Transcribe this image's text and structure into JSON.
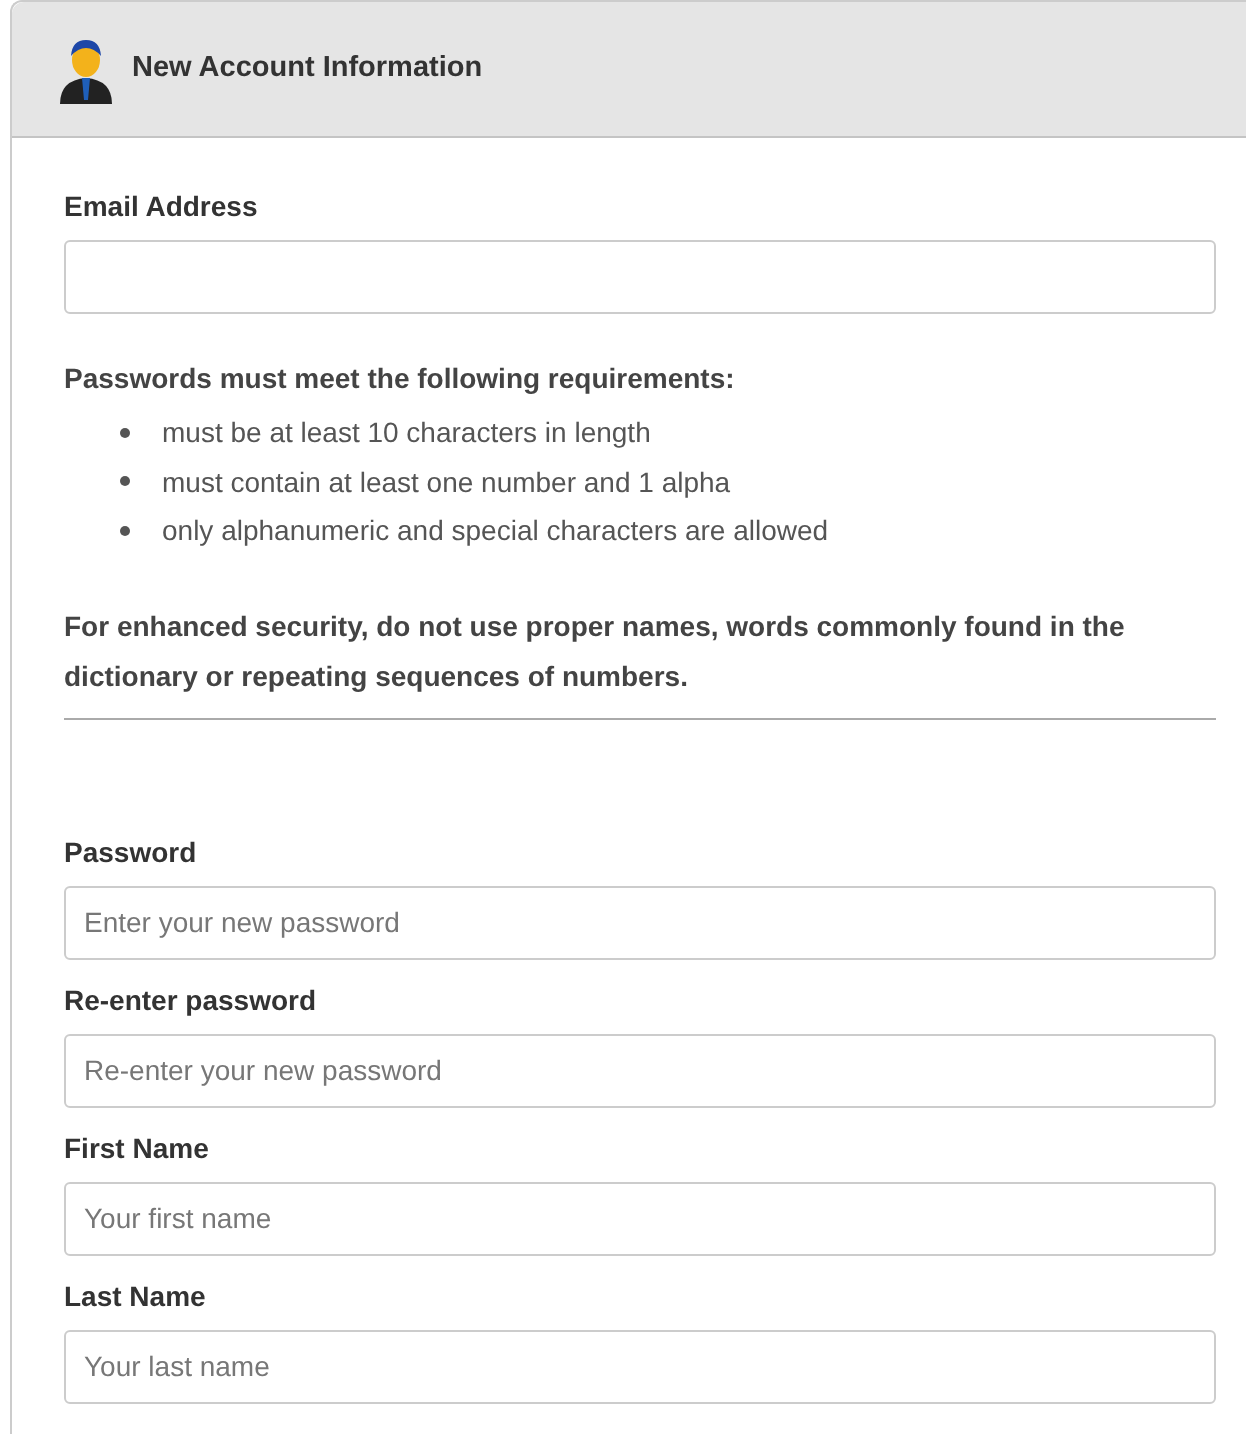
{
  "panel": {
    "title": "New Account Information"
  },
  "email": {
    "label": "Email Address"
  },
  "requirements": {
    "heading": "Passwords must meet the following requirements:",
    "items": [
      "must be at least 10 characters in length",
      "must contain at least one number and 1 alpha",
      "only alphanumeric and special characters are allowed"
    ],
    "note": "For enhanced security, do not use proper names, words commonly found in the dictionary or repeating sequences of numbers."
  },
  "fields": [
    {
      "label": "Password",
      "placeholder": "Enter your new password"
    },
    {
      "label": "Re-enter password",
      "placeholder": "Re-enter your new password"
    },
    {
      "label": "First Name",
      "placeholder": "Your first name"
    },
    {
      "label": "Last Name",
      "placeholder": "Your last name"
    }
  ]
}
